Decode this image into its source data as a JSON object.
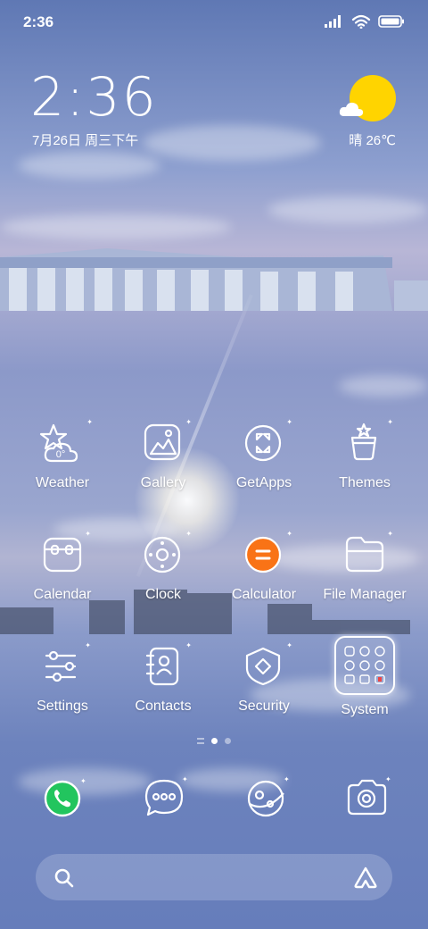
{
  "status_bar": {
    "time": "2:36",
    "icons": [
      "signal-icon",
      "wifi-icon",
      "battery-icon"
    ]
  },
  "clock_widget": {
    "time": "2:36",
    "date": "7月26日 周三下午"
  },
  "weather_widget": {
    "label": "晴 26℃",
    "sun_color": "#ffd400"
  },
  "weather_app_badge": "0°",
  "apps": [
    {
      "label": "Weather",
      "icon": "weather-icon"
    },
    {
      "label": "Gallery",
      "icon": "gallery-icon"
    },
    {
      "label": "GetApps",
      "icon": "getapps-icon"
    },
    {
      "label": "Themes",
      "icon": "themes-icon"
    },
    {
      "label": "Calendar",
      "icon": "calendar-icon"
    },
    {
      "label": "Clock",
      "icon": "clock-icon"
    },
    {
      "label": "Calculator",
      "icon": "calculator-icon"
    },
    {
      "label": "File Manager",
      "icon": "file-manager-icon"
    },
    {
      "label": "Settings",
      "icon": "settings-icon"
    },
    {
      "label": "Contacts",
      "icon": "contacts-icon"
    },
    {
      "label": "Security",
      "icon": "security-icon"
    },
    {
      "label": "System",
      "icon": "system-folder-icon"
    }
  ],
  "page_indicator": {
    "pages": 2,
    "current": 1
  },
  "dock": [
    {
      "icon": "phone-icon",
      "accent": "#22c55e"
    },
    {
      "icon": "messages-icon"
    },
    {
      "icon": "browser-icon"
    },
    {
      "icon": "camera-icon"
    }
  ],
  "search_bar": {
    "left_icon": "search-icon",
    "right_icon": "assistant-icon"
  },
  "colors": {
    "calculator_accent": "#f97316",
    "phone_accent": "#22c55e"
  }
}
